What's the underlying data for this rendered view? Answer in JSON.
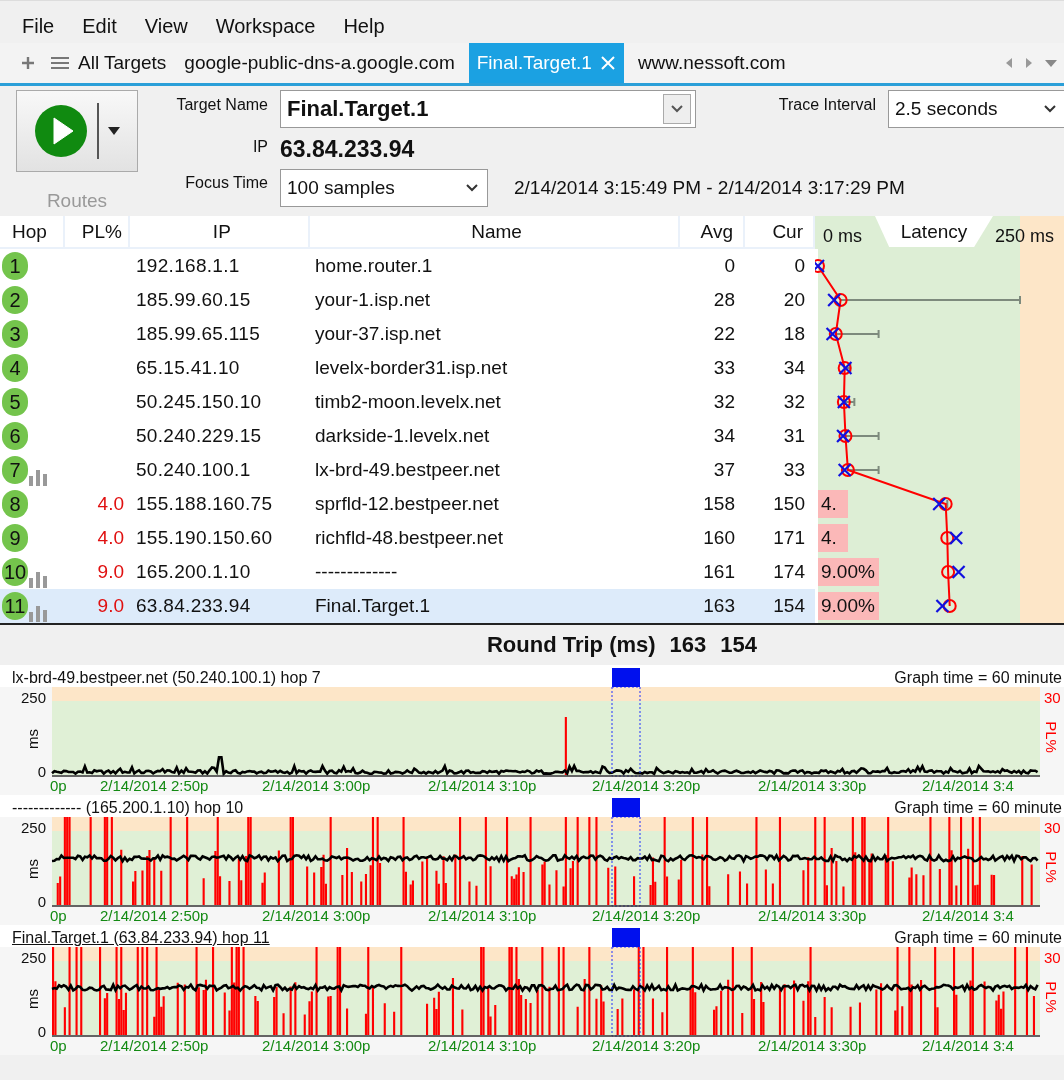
{
  "menu": [
    "File",
    "Edit",
    "View",
    "Workspace",
    "Help"
  ],
  "tabs": [
    {
      "label": "All Targets",
      "kind": "list",
      "selected": false
    },
    {
      "label": "google-public-dns-a.google.com",
      "kind": "target",
      "selected": false
    },
    {
      "label": "Final.Target.1",
      "kind": "target",
      "selected": true
    },
    {
      "label": "www.nessoft.com",
      "kind": "target",
      "selected": false
    }
  ],
  "toolbar": {
    "routes_label": "Routes",
    "target_name_label": "Target Name",
    "target_name": "Final.Target.1",
    "trace_interval_label": "Trace Interval",
    "trace_interval": "2.5 seconds",
    "ip_label": "IP",
    "ip": "63.84.233.94",
    "focus_time_label": "Focus Time",
    "focus_time": "100 samples",
    "time_range": "2/14/2014 3:15:49 PM - 2/14/2014 3:17:29 PM"
  },
  "table": {
    "columns": [
      "Hop",
      "PL%",
      "IP",
      "Name",
      "Avg",
      "Cur"
    ],
    "latency_header": {
      "min": "0 ms",
      "title": "Latency",
      "max": "250 ms"
    },
    "rows": [
      {
        "hop": "1",
        "ip": "192.168.1.1",
        "name": "home.router.1",
        "avg": "0",
        "cur": "0",
        "graphed": false,
        "selected": false
      },
      {
        "hop": "2",
        "ip": "185.99.60.15",
        "name": "your-1.isp.net",
        "avg": "28",
        "cur": "20",
        "graphed": false,
        "selected": false
      },
      {
        "hop": "3",
        "ip": "185.99.65.115",
        "name": "your-37.isp.net",
        "avg": "22",
        "cur": "18",
        "graphed": false,
        "selected": false
      },
      {
        "hop": "4",
        "ip": "65.15.41.10",
        "name": "levelx-border31.isp.net",
        "avg": "33",
        "cur": "34",
        "graphed": false,
        "selected": false
      },
      {
        "hop": "5",
        "ip": "50.245.150.10",
        "name": "timb2-moon.levelx.net",
        "avg": "32",
        "cur": "32",
        "graphed": false,
        "selected": false
      },
      {
        "hop": "6",
        "ip": "50.240.229.15",
        "name": "darkside-1.levelx.net",
        "avg": "34",
        "cur": "31",
        "graphed": false,
        "selected": false
      },
      {
        "hop": "7",
        "ip": "50.240.100.1",
        "name": "lx-brd-49.bestpeer.net",
        "avg": "37",
        "cur": "33",
        "graphed": true,
        "selected": false
      },
      {
        "hop": "8",
        "pl": "4.0",
        "ip": "155.188.160.75",
        "name": "sprfld-12.bestpeer.net",
        "avg": "158",
        "cur": "150",
        "pl_bar": "4.",
        "graphed": false,
        "selected": false
      },
      {
        "hop": "9",
        "pl": "4.0",
        "ip": "155.190.150.60",
        "name": "richfld-48.bestpeer.net",
        "avg": "160",
        "cur": "171",
        "pl_bar": "4.",
        "graphed": false,
        "selected": false
      },
      {
        "hop": "10",
        "pl": "9.0",
        "ip": "165.200.1.10",
        "name": "-------------",
        "avg": "161",
        "cur": "174",
        "pl_bar": "9.00%",
        "graphed": true,
        "selected": false
      },
      {
        "hop": "11",
        "pl": "9.0",
        "ip": "63.84.233.94",
        "name": "Final.Target.1",
        "avg": "163",
        "cur": "154",
        "pl_bar": "9.00%",
        "graphed": true,
        "selected": true
      }
    ]
  },
  "round_trip": {
    "label": "Round Trip (ms)",
    "avg": "163",
    "cur": "154"
  },
  "graphs": [
    {
      "title": "lx-brd-49.bestpeer.net (50.240.100.1) hop 7",
      "graph_time": "Graph time = 60 minute",
      "selected": false,
      "y_max": "250",
      "y_min": "0",
      "y_label": "ms",
      "pl_max": "30",
      "pl_label": "PL%",
      "x_labels": [
        "0p",
        "2/14/2014 2:50p",
        "2/14/2014 3:00p",
        "2/14/2014 3:10p",
        "2/14/2014 3:20p",
        "2/14/2014 3:30p",
        "2/14/2014 3:4"
      ]
    },
    {
      "title": "------------- (165.200.1.10) hop 10",
      "graph_time": "Graph time = 60 minute",
      "selected": false,
      "y_max": "250",
      "y_min": "0",
      "y_label": "ms",
      "pl_max": "30",
      "pl_label": "PL%",
      "x_labels": [
        "0p",
        "2/14/2014 2:50p",
        "2/14/2014 3:00p",
        "2/14/2014 3:10p",
        "2/14/2014 3:20p",
        "2/14/2014 3:30p",
        "2/14/2014 3:4"
      ]
    },
    {
      "title": "Final.Target.1 (63.84.233.94) hop 11",
      "graph_time": "Graph time = 60 minute",
      "selected": true,
      "y_max": "250",
      "y_min": "0",
      "y_label": "ms",
      "pl_max": "30",
      "pl_label": "PL%",
      "x_labels": [
        "0p",
        "2/14/2014 2:50p",
        "2/14/2014 3:00p",
        "2/14/2014 3:10p",
        "2/14/2014 3:20p",
        "2/14/2014 3:30p",
        "2/14/2014 3:4"
      ]
    }
  ]
}
